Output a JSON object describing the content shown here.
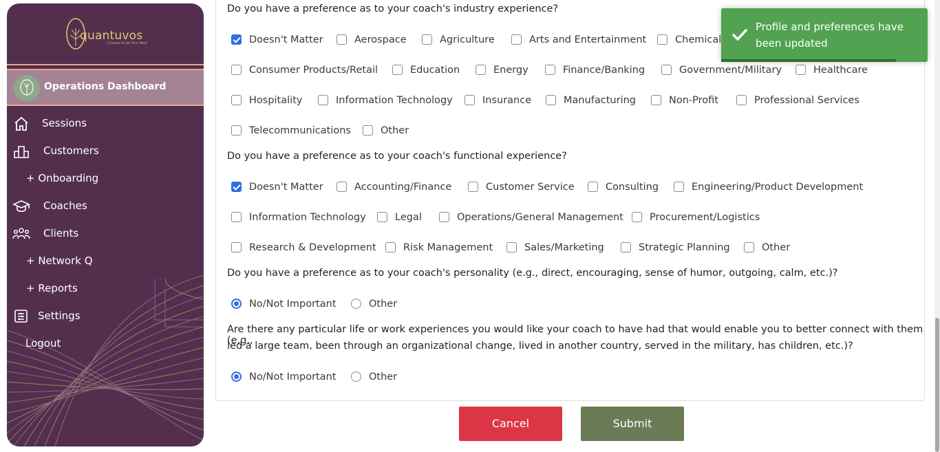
{
  "brand": {
    "name": "quantuvos",
    "tagline": "Choose to be Your Best",
    "accent": "#e6c47a"
  },
  "sidebar": {
    "dashboard_label": "Operations Dashboard",
    "items": [
      {
        "label": "Sessions",
        "icon": "home-icon"
      },
      {
        "label": "Customers",
        "icon": "building-icon"
      },
      {
        "label": "+ Onboarding",
        "icon": ""
      },
      {
        "label": "Coaches",
        "icon": "graduation-cap-icon"
      },
      {
        "label": "Clients",
        "icon": "people-icon"
      },
      {
        "label": "+ Network Q",
        "icon": ""
      },
      {
        "label": "+ Reports",
        "icon": ""
      },
      {
        "label": "Settings",
        "icon": "settings-list-icon"
      },
      {
        "label": "Logout",
        "icon": ""
      }
    ]
  },
  "form": {
    "industry_question": "Do you have a preference as to your coach's industry experience?",
    "industry_options": [
      {
        "label": "Doesn't Matter",
        "checked": true
      },
      {
        "label": "Aerospace",
        "checked": false
      },
      {
        "label": "Agriculture",
        "checked": false
      },
      {
        "label": "Arts and Entertainment",
        "checked": false
      },
      {
        "label": "Chemical/I",
        "checked": false
      },
      {
        "label": "Consumer Products/Retail",
        "checked": false
      },
      {
        "label": "Education",
        "checked": false
      },
      {
        "label": "Energy",
        "checked": false
      },
      {
        "label": "Finance/Banking",
        "checked": false
      },
      {
        "label": "Government/Military",
        "checked": false
      },
      {
        "label": "Healthcare",
        "checked": false
      },
      {
        "label": "Hospitality",
        "checked": false
      },
      {
        "label": "Information Technology",
        "checked": false
      },
      {
        "label": "Insurance",
        "checked": false
      },
      {
        "label": "Manufacturing",
        "checked": false
      },
      {
        "label": "Non-Profit",
        "checked": false
      },
      {
        "label": "Professional Services",
        "checked": false
      },
      {
        "label": "Telecommunications",
        "checked": false
      },
      {
        "label": "Other",
        "checked": false
      }
    ],
    "functional_question": "Do you have a preference as to your coach's functional experience?",
    "functional_options": [
      {
        "label": "Doesn't Matter",
        "checked": true
      },
      {
        "label": "Accounting/Finance",
        "checked": false
      },
      {
        "label": "Customer Service",
        "checked": false
      },
      {
        "label": "Consulting",
        "checked": false
      },
      {
        "label": "Engineering/Product Development",
        "checked": false
      },
      {
        "label": "Information Technology",
        "checked": false
      },
      {
        "label": "Legal",
        "checked": false
      },
      {
        "label": "Operations/General Management",
        "checked": false
      },
      {
        "label": "Procurement/Logistics",
        "checked": false
      },
      {
        "label": "Research & Development",
        "checked": false
      },
      {
        "label": "Risk Management",
        "checked": false
      },
      {
        "label": "Sales/Marketing",
        "checked": false
      },
      {
        "label": "Strategic Planning",
        "checked": false
      },
      {
        "label": "Other",
        "checked": false
      }
    ],
    "personality_question": "Do you have a preference as to your coach's personality (e.g., direct, encouraging, sense of humor, outgoing, calm, etc.)?",
    "personality_options": [
      {
        "label": "No/Not Important",
        "selected": true
      },
      {
        "label": "Other",
        "selected": false
      }
    ],
    "experience_question_line1": "Are there any particular life or work experiences you would like your coach to have had that would enable you to better connect with them (e.g.,",
    "experience_question_line2": "led a large team, been through an organizational change, lived in another country, served in the military, has children, etc.)?",
    "experience_options": [
      {
        "label": "No/Not Important",
        "selected": true
      },
      {
        "label": "Other",
        "selected": false
      }
    ],
    "cancel_label": "Cancel",
    "submit_label": "Submit"
  },
  "toast": {
    "message": "Profile and preferences have been updated",
    "color": "#51a351"
  }
}
